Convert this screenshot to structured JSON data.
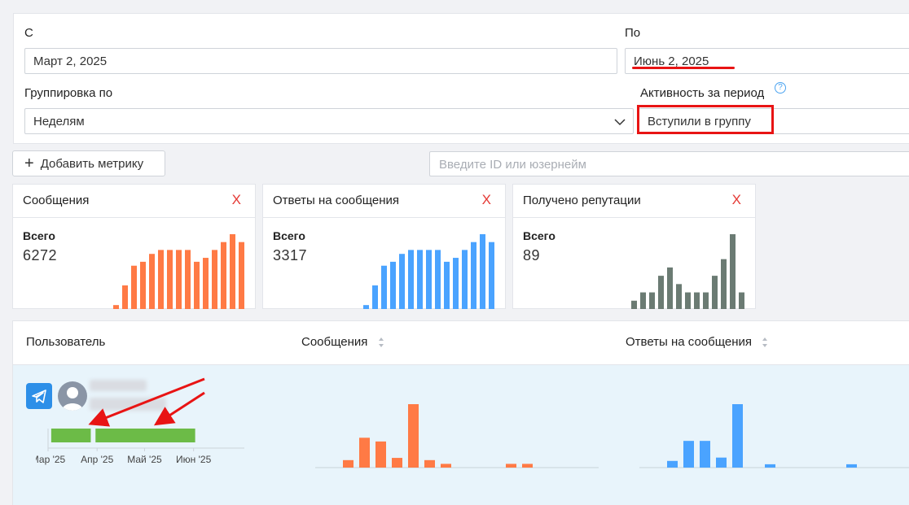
{
  "filters": {
    "from_label": "С",
    "from_value": "Март 2, 2025",
    "to_label": "По",
    "to_value": "Июнь 2, 2025",
    "group_label": "Группировка по",
    "group_value": "Неделям",
    "activity_label": "Активность за период",
    "activity_value": "Вступили в группу",
    "help_glyph": "?"
  },
  "toolbar": {
    "add_metric_plus": "+",
    "add_metric_label": "Добавить метрику",
    "search_placeholder": "Введите ID или юзернейм"
  },
  "cards": [
    {
      "title": "Сообщения",
      "close": "X",
      "total_label": "Всего",
      "total_value": "6272",
      "color": "#ff7a45",
      "values": [
        1,
        6,
        11,
        12,
        14,
        15,
        15,
        15,
        15,
        12,
        13,
        15,
        17,
        19,
        17
      ]
    },
    {
      "title": "Ответы на сообщения",
      "close": "X",
      "total_label": "Всего",
      "total_value": "3317",
      "color": "#4aa3ff",
      "values": [
        1,
        6,
        11,
        12,
        14,
        15,
        15,
        15,
        15,
        12,
        13,
        15,
        17,
        19,
        17
      ]
    },
    {
      "title": "Получено репутации",
      "close": "X",
      "total_label": "Всего",
      "total_value": "89",
      "color": "#6b7b73",
      "values": [
        1,
        2,
        2,
        4,
        5,
        3,
        2,
        2,
        2,
        4,
        6,
        9,
        2
      ]
    }
  ],
  "table": {
    "columns": [
      {
        "label": "Пользователь"
      },
      {
        "label": "Сообщения"
      },
      {
        "label": "Ответы на сообщения"
      }
    ],
    "row": {
      "user_activity": {
        "color": "#6cbb47",
        "x_ticks": [
          "Мар '25",
          "Апр '25",
          "Май '25",
          "Июн '25"
        ],
        "segments": [
          {
            "start": "2025-03-03",
            "end": "2025-03-28"
          },
          {
            "start": "2025-03-31",
            "end": "2025-06-02"
          }
        ]
      },
      "messages_chart": {
        "color": "#ff7a45",
        "values": [
          1,
          4,
          3.5,
          1.3,
          8.5,
          1,
          0.5,
          0,
          0,
          0,
          0.5,
          0.5
        ]
      },
      "replies_chart": {
        "color": "#4aa3ff",
        "values": [
          1,
          4,
          4,
          1.5,
          9.5,
          0,
          0.5,
          0,
          0,
          0,
          0,
          0.5
        ]
      }
    }
  },
  "annotation_color": "#e81414"
}
